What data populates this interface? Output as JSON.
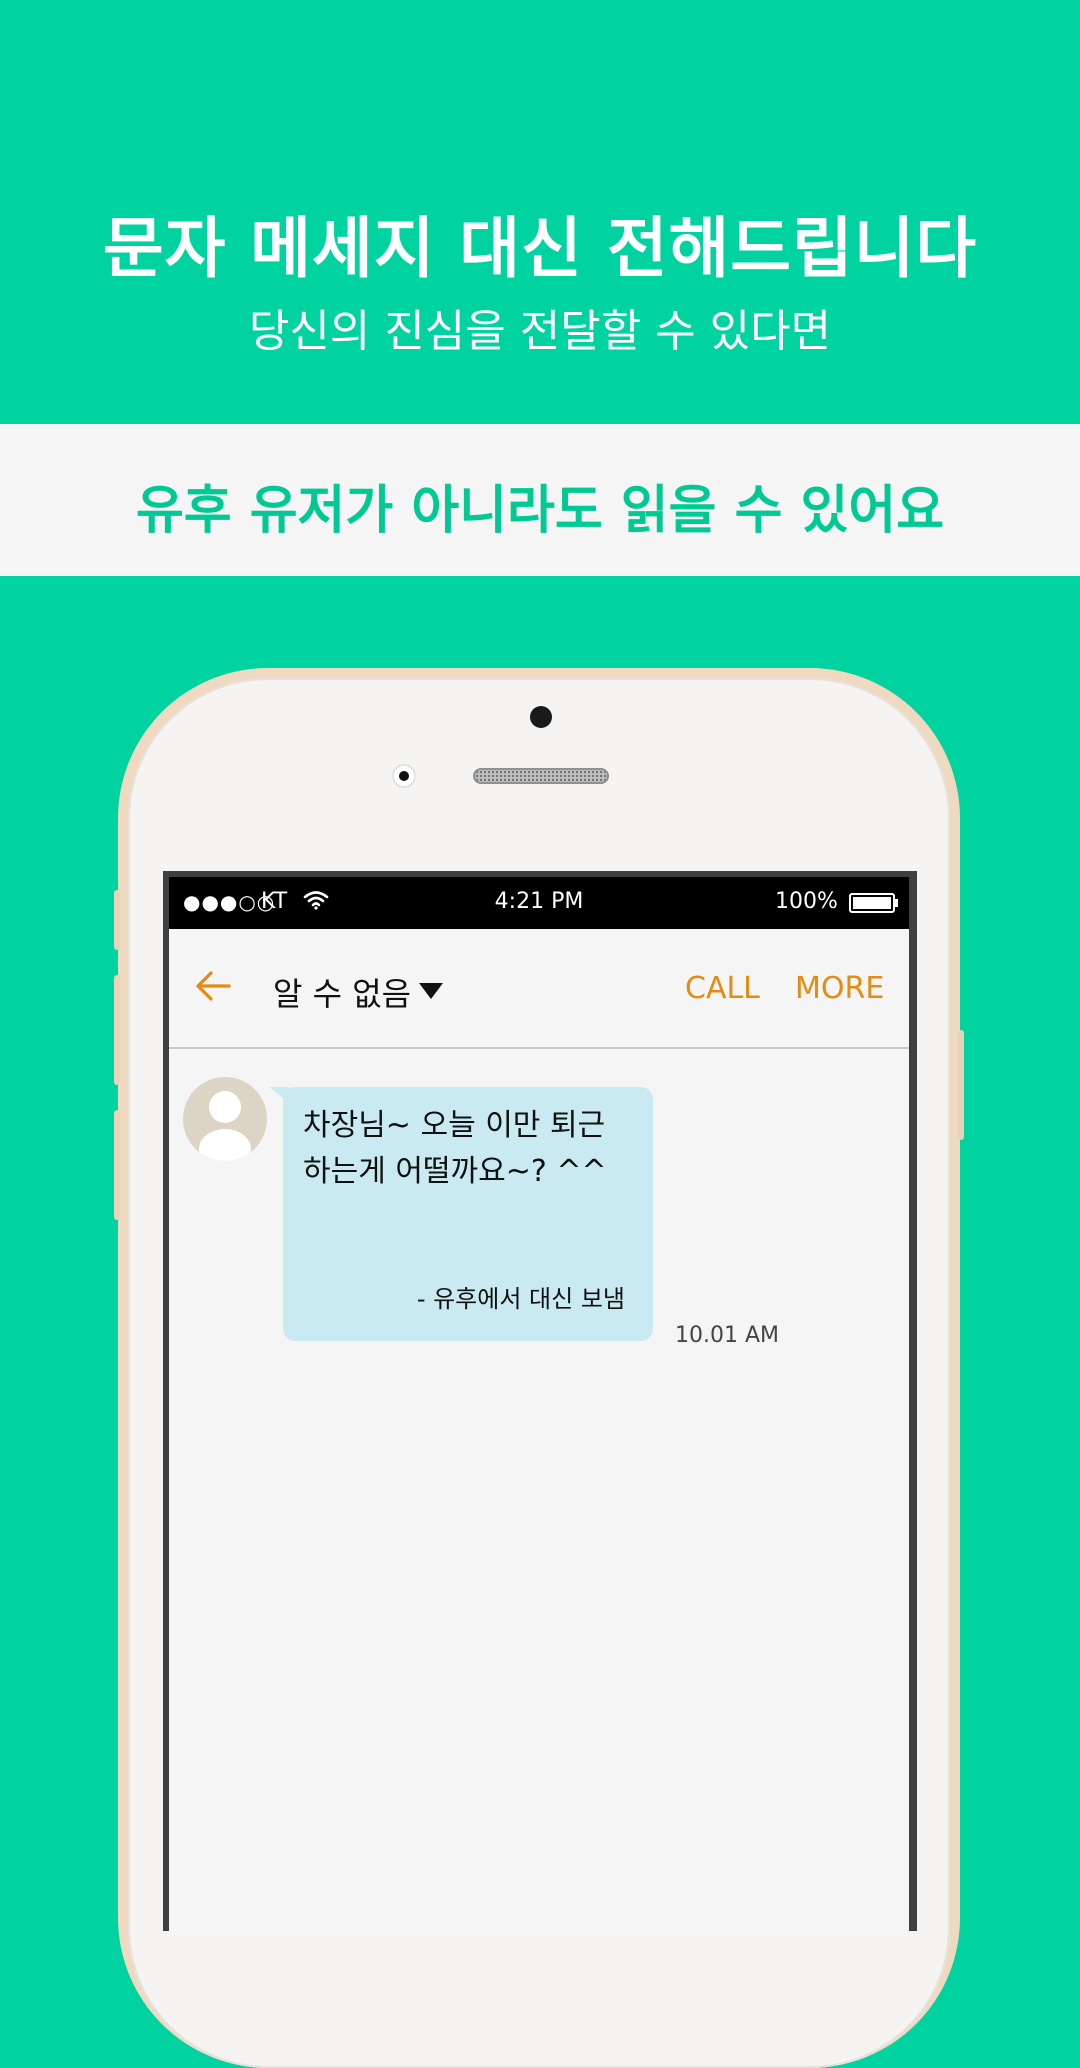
{
  "hero": {
    "title": "문자 메세지 대신 전해드립니다",
    "subtitle": "당신의 진심을 전달할 수 있다면"
  },
  "banner": {
    "text": "유후 유저가 아니라도 읽을 수 있어요"
  },
  "status_bar": {
    "signal": "●●●○○",
    "carrier": "KT",
    "time": "4:21 PM",
    "battery": "100%"
  },
  "header": {
    "contact_name": "알 수 없음",
    "call_label": "CALL",
    "more_label": "MORE"
  },
  "message": {
    "text_line1": "차장님~ 오늘 이만 퇴근",
    "text_line2": "하는게 어떨까요~? ^^",
    "signature": "- 유후에서 대신 보냄",
    "time": "10.01 AM"
  },
  "colors": {
    "background": "#00d39f",
    "accent": "#e58a12",
    "bubble": "#caeaf1",
    "banner_text": "#00c993"
  }
}
